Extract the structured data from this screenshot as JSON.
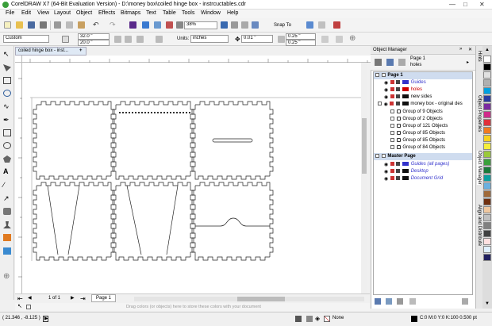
{
  "window": {
    "title": "CorelDRAW X7 (64-Bit Evaluation Version) - D:\\money box\\coiled hinge box - instrcuctables.cdr"
  },
  "menu": [
    "File",
    "Edit",
    "View",
    "Layout",
    "Object",
    "Effects",
    "Bitmaps",
    "Text",
    "Table",
    "Tools",
    "Window",
    "Help"
  ],
  "toolbar": {
    "zoom": "38%",
    "snap_to": "Snap To"
  },
  "propbar": {
    "paper_type": "Custom",
    "width": "32.0 \"",
    "height": "20.0 \"",
    "units_label": "Units:",
    "units": "inches",
    "nudge": "0.01 \"",
    "dup_x": "0.25 \"",
    "dup_y": "0.25 \""
  },
  "doc": {
    "tab_label": "coiled hinge box - inst...",
    "page_count": "1 of 1",
    "page_tab": "Page 1",
    "hint": "Drag colors (or objects) here to store these colors with your document"
  },
  "object_manager": {
    "title": "Object Manager",
    "current_page": "Page 1",
    "current_layer": "holes",
    "rows": [
      {
        "label": "Page 1",
        "kind": "page"
      },
      {
        "label": "Guides",
        "kind": "layer",
        "color": "#3333cc"
      },
      {
        "label": "holes",
        "kind": "layer-active",
        "color": "#cc0000"
      },
      {
        "label": "new sides",
        "kind": "layer",
        "color": "#111111"
      },
      {
        "label": "money box - original des",
        "kind": "layer",
        "color": "#111111"
      },
      {
        "label": "Group of 9 Objects",
        "kind": "group"
      },
      {
        "label": "Group of 2 Objects",
        "kind": "group"
      },
      {
        "label": "Group of 121 Objects",
        "kind": "group"
      },
      {
        "label": "Group of 85 Objects",
        "kind": "group"
      },
      {
        "label": "Group of 85 Objects",
        "kind": "group"
      },
      {
        "label": "Group of 84 Objects",
        "kind": "group"
      },
      {
        "label": "Master Page",
        "kind": "page"
      },
      {
        "label": "Guides (all pages)",
        "kind": "master",
        "color": "#3333cc"
      },
      {
        "label": "Desktop",
        "kind": "master",
        "color": "#111111"
      },
      {
        "label": "Document Grid",
        "kind": "master",
        "color": "#111111"
      }
    ]
  },
  "docker_tabs": [
    "Hints",
    "Object Properties",
    "Object Manager",
    "Align and Distribute"
  ],
  "palette": [
    "#ffffff",
    "#000000",
    "#e0e0e0",
    "#b0b0b0",
    "#00a0e0",
    "#2a3aa0",
    "#7a2aa0",
    "#d02a8a",
    "#e0303a",
    "#f07a20",
    "#f7d11e",
    "#f5ee3a",
    "#9ac93a",
    "#3aa03a",
    "#1a7a3a",
    "#0aa0a0",
    "#6ab0e0",
    "#a06a3a",
    "#703010",
    "#f0c8a0",
    "#c0c0c0",
    "#808080",
    "#404040",
    "#ffe0e0",
    "#e0f0ff",
    "#202060"
  ],
  "status": {
    "coords": "( 21.346 , -8.125 )",
    "fill": "None",
    "outline": "C:0 M:0 Y:0 K:100  0.500 pt"
  },
  "icons": [
    "arrow-icon",
    "shape-icon",
    "crop-icon",
    "zoom-icon",
    "freehand-icon",
    "rectangle-icon",
    "ellipse-icon",
    "polygon-icon",
    "text-icon",
    "connector-icon",
    "eyedropper-icon",
    "fill-icon",
    "eye-icon",
    "lock-icon",
    "printer-icon"
  ]
}
